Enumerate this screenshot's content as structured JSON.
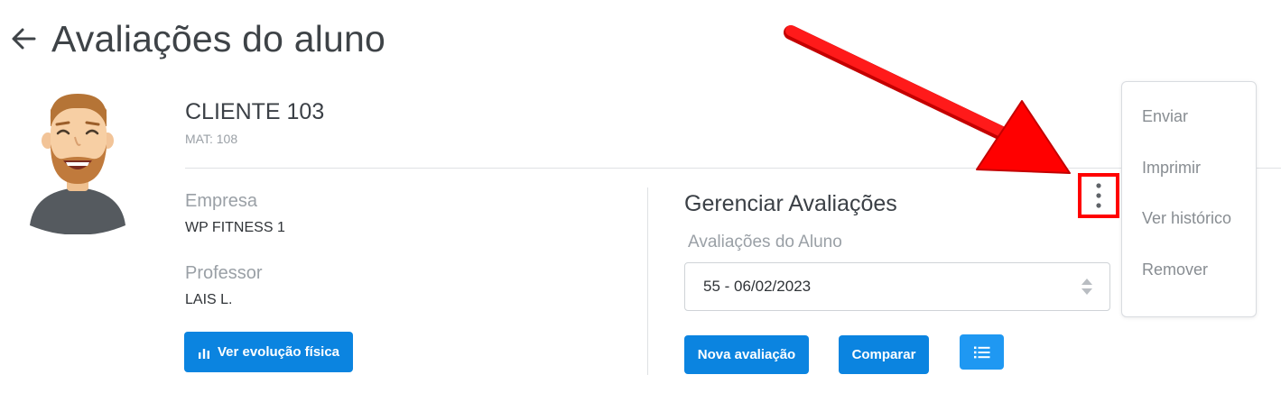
{
  "page": {
    "title": "Avaliações do aluno"
  },
  "client": {
    "name": "CLIENTE 103",
    "mat": "MAT: 108"
  },
  "info": {
    "empresa_label": "Empresa",
    "empresa_value": "WP FITNESS 1",
    "professor_label": "Professor",
    "professor_value": "LAIS L.",
    "evolution_button": "Ver evolução física"
  },
  "manage": {
    "title": "Gerenciar Avaliações",
    "select_label": "Avaliações do Aluno",
    "selected_value": "55 - 06/02/2023",
    "new_button": "Nova avaliação",
    "compare_button": "Comparar"
  },
  "menu": {
    "items": [
      "Enviar",
      "Imprimir",
      "Ver histórico",
      "Remover"
    ]
  },
  "icons": {
    "back": "arrow-left-icon",
    "evolution": "bar-chart-icon",
    "list": "list-icon",
    "kebab": "vertical-dots-icon",
    "select": "sort-arrows-icon"
  },
  "colors": {
    "primary": "#0b84e0",
    "list_button": "#1f98f2",
    "highlight": "#ff0000"
  }
}
